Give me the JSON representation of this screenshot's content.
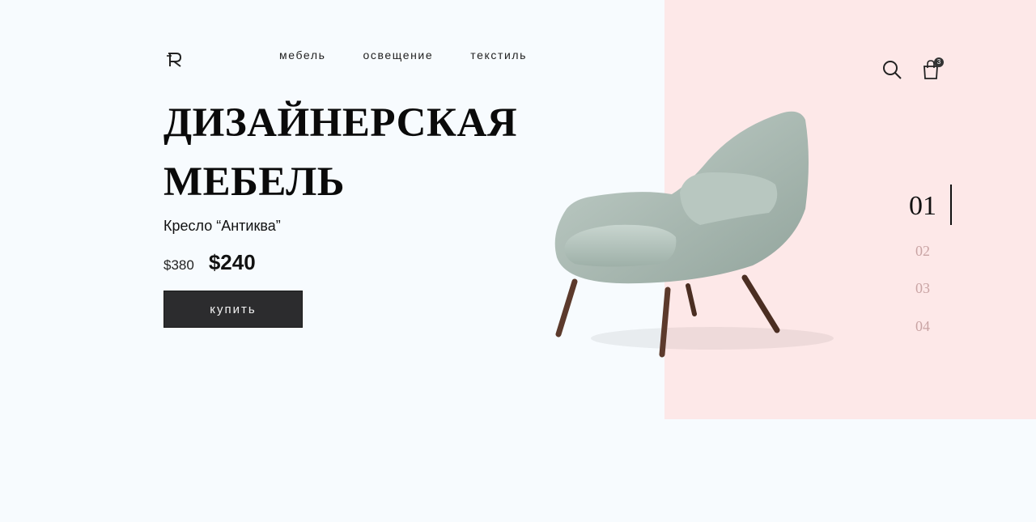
{
  "header": {
    "nav": [
      {
        "label": "мебель"
      },
      {
        "label": "освещение"
      },
      {
        "label": "текстиль"
      }
    ],
    "logo_icon": "monogram-r-icon",
    "search_icon": "search-icon",
    "cart_icon": "shopping-bag-icon",
    "cart_count": "3"
  },
  "hero": {
    "title_line1": "ДИЗАЙНЕРСКАЯ",
    "title_line2": "МЕБЕЛЬ",
    "product_name": "Кресло “Антиква”",
    "old_price": "$380",
    "new_price": "$240",
    "buy_label": "купить"
  },
  "slider": {
    "items": [
      "01",
      "02",
      "03",
      "04"
    ],
    "active": "01"
  },
  "colors": {
    "background": "#f7fbfe",
    "panel": "#fde8e8",
    "button": "#2c2c2e",
    "chair": "#aebdb6",
    "inactive_number": "#c9a4a4"
  }
}
